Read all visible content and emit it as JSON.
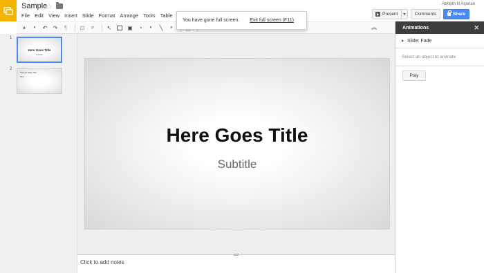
{
  "header": {
    "doc_title": "Sample",
    "user_name": "Abhijith N Arjunan",
    "present_label": "Present",
    "comments_label": "Comments",
    "share_label": "Share"
  },
  "menu": [
    "File",
    "Edit",
    "View",
    "Insert",
    "Slide",
    "Format",
    "Arrange",
    "Tools",
    "Table",
    "He"
  ],
  "notice": {
    "message": "You have gone full screen.",
    "exit_link": "Exit full screen (F11)"
  },
  "filmstrip": {
    "slides": [
      {
        "number": "1",
        "title": "Here Goes Title",
        "subtitle": "Subtitle"
      },
      {
        "number": "2",
        "title": "Sample Slide Title",
        "subtitle": "Text"
      }
    ]
  },
  "slide": {
    "title": "Here Goes Title",
    "subtitle": "Subtitle"
  },
  "notes": {
    "placeholder": "Click to add notes"
  },
  "animations": {
    "title": "Animations",
    "slide_transition": "Slide: Fade",
    "hint": "Select an object to animate",
    "play_label": "Play"
  },
  "colors": {
    "accent": "#4a8af4",
    "logo": "#f4b400",
    "panel_header": "#3c3c3c"
  },
  "icons": [
    "slides-logo-icon",
    "star-icon",
    "folder-icon",
    "play-icon",
    "lock-icon",
    "undo-icon",
    "redo-icon",
    "zoom-icon",
    "cursor-icon",
    "textbox-icon",
    "image-icon",
    "shape-icon",
    "line-icon",
    "collapse-icon",
    "close-icon"
  ]
}
